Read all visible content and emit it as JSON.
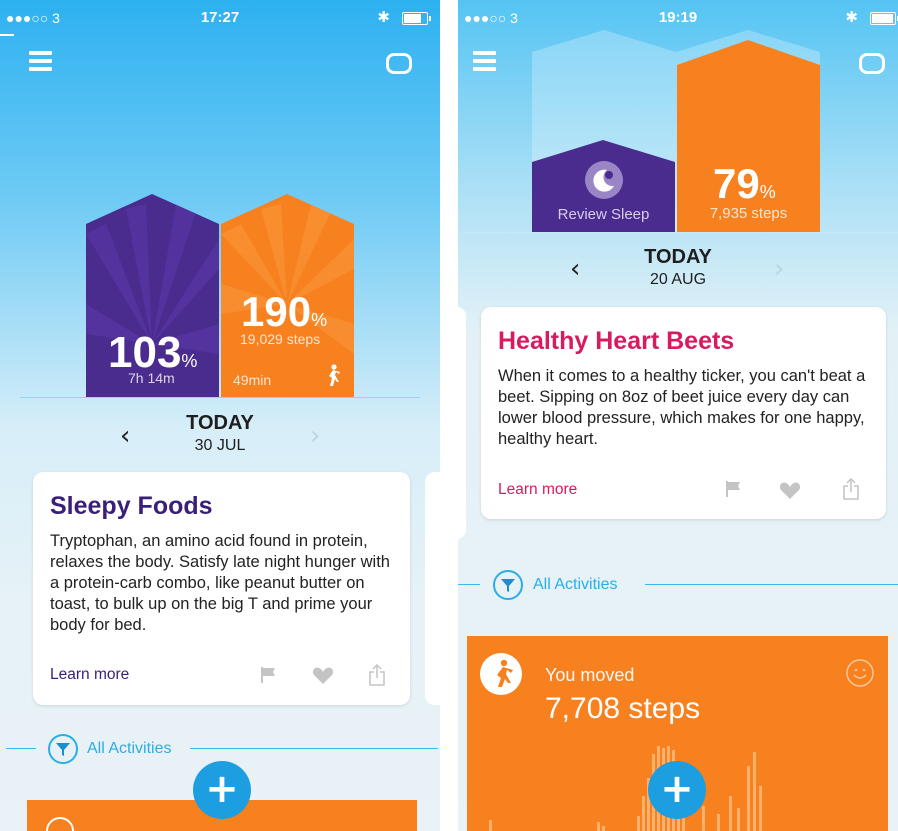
{
  "colors": {
    "sky_top": "#2db1f0",
    "sleep_purple": "#4a2b8e",
    "activity_orange": "#f7801f",
    "accent_blue": "#2aaee8",
    "title_purple": "#3a1f7a",
    "title_pink": "#d81b60"
  },
  "screen1": {
    "status": {
      "carrier": "●●●○○ 3",
      "time": "17:27",
      "battery_level": 0.8
    },
    "sleep_bar": {
      "value": "103",
      "unit": "%",
      "sub": "7h 14m",
      "icon": "moon-icon"
    },
    "activity_bar": {
      "value": "190",
      "unit": "%",
      "steps": "19,029 steps",
      "duration": "49min",
      "icon": "runner-icon"
    },
    "date": {
      "label": "TODAY",
      "day": "30 JUL"
    },
    "card": {
      "title": "Sleepy Foods",
      "body": "Tryptophan, an amino acid found in protein, relaxes the body. Satisfy late night hunger with a protein-carb combo, like peanut butter on toast, to bulk up on the big T and prime your body for bed.",
      "learn_more": "Learn more"
    },
    "filter_label": "All Activities",
    "add_label": "+"
  },
  "screen2": {
    "status": {
      "carrier": "●●●○○ 3",
      "time": "19:19",
      "battery_level": 1.0
    },
    "sleep_bar": {
      "label": "Review Sleep",
      "icon": "sleep-review-icon"
    },
    "activity_bar": {
      "value": "79",
      "unit": "%",
      "steps": "7,935 steps"
    },
    "date": {
      "label": "TODAY",
      "day": "20 AUG"
    },
    "card": {
      "title": "Healthy Heart Beets",
      "body": "When it comes to a healthy ticker, you can't beat a beet. Sipping on 8oz of beet juice every day can lower blood pressure, which makes for one happy, healthy heart.",
      "learn_more": "Learn more"
    },
    "filter_label": "All Activities",
    "activity": {
      "label": "You moved",
      "steps": "7,708 steps",
      "icon": "smiley-icon"
    },
    "add_label": "+"
  }
}
